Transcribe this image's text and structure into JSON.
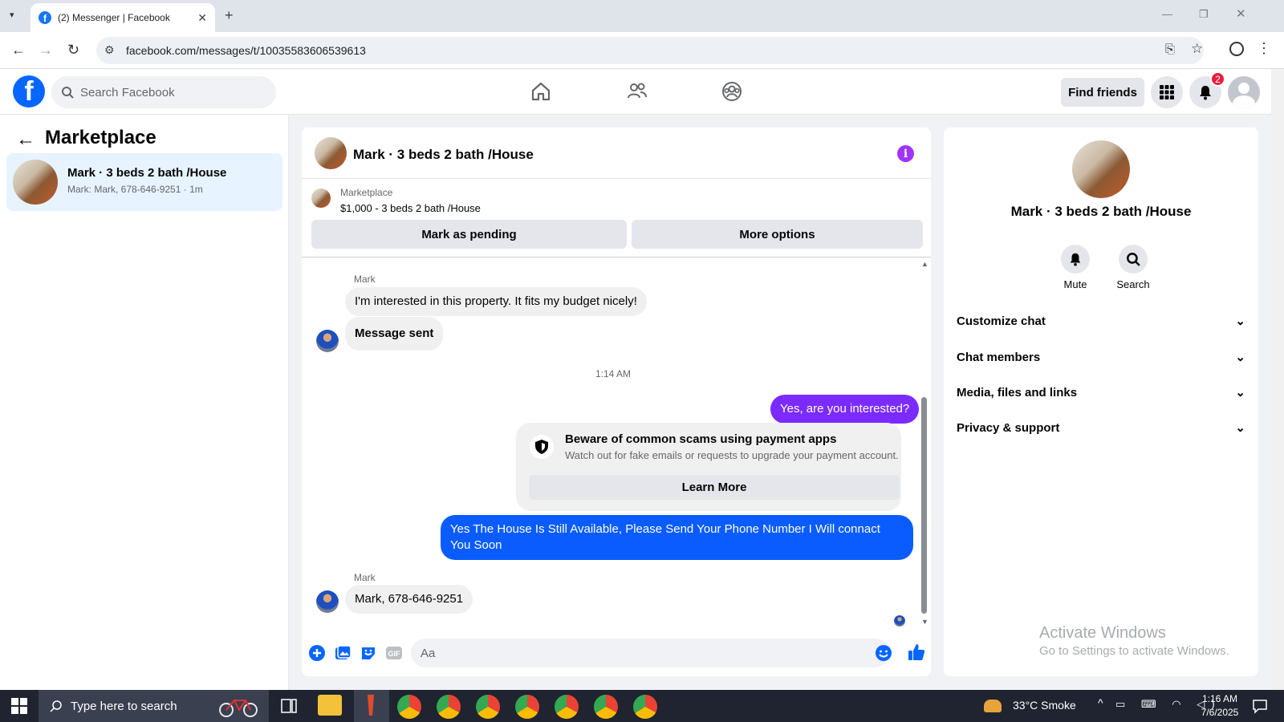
{
  "browser": {
    "tab_title": "(2) Messenger | Facebook",
    "url": "facebook.com/messages/t/10035583606539613"
  },
  "topbar": {
    "search_placeholder": "Search Facebook",
    "find_friends": "Find friends",
    "notification_count": "2",
    "nav_icons": [
      "home-icon",
      "friends-icon",
      "groups-icon"
    ]
  },
  "left_panel": {
    "title": "Marketplace",
    "conversations": [
      {
        "name": "Mark · 3 beds 2 bath /House",
        "preview": "Mark: Mark, 678-646-9251 · 1m"
      }
    ]
  },
  "chat": {
    "title": "Mark · 3 beds 2 bath /House",
    "marketplace_label": "Marketplace",
    "listing": "$1,000 - 3 beds 2 bath /House",
    "mark_pending": "Mark as pending",
    "more_options": "More options",
    "messages": {
      "sender1": "Mark",
      "msg1": "I'm interested in this property. It fits my budget nicely!",
      "msg2": "Message sent",
      "time": "1:14 AM",
      "msg3": "Yes, are you interested?",
      "scam_title": "Beware of common scams using payment apps",
      "scam_desc": "Watch out for fake emails or requests to upgrade your payment account.",
      "learn_more": "Learn More",
      "msg4": "Yes The House Is Still Available, Please Send Your Phone Number I Will connact You Soon",
      "sender2": "Mark",
      "msg5": "Mark, 678-646-9251"
    },
    "composer_placeholder": "Aa",
    "accent_purple": "#7b2bff",
    "accent_blue": "#0a5cff"
  },
  "right_panel": {
    "title": "Mark · 3 beds 2 bath /House",
    "mute": "Mute",
    "search": "Search",
    "sections": [
      "Customize chat",
      "Chat members",
      "Media, files and links",
      "Privacy & support"
    ]
  },
  "watermark": {
    "line1": "Activate Windows",
    "line2": "Go to Settings to activate Windows."
  },
  "taskbar": {
    "search_placeholder": "Type here to search",
    "weather": "33°C  Smoke",
    "time": "1:16 AM",
    "date": "7/6/2025"
  }
}
